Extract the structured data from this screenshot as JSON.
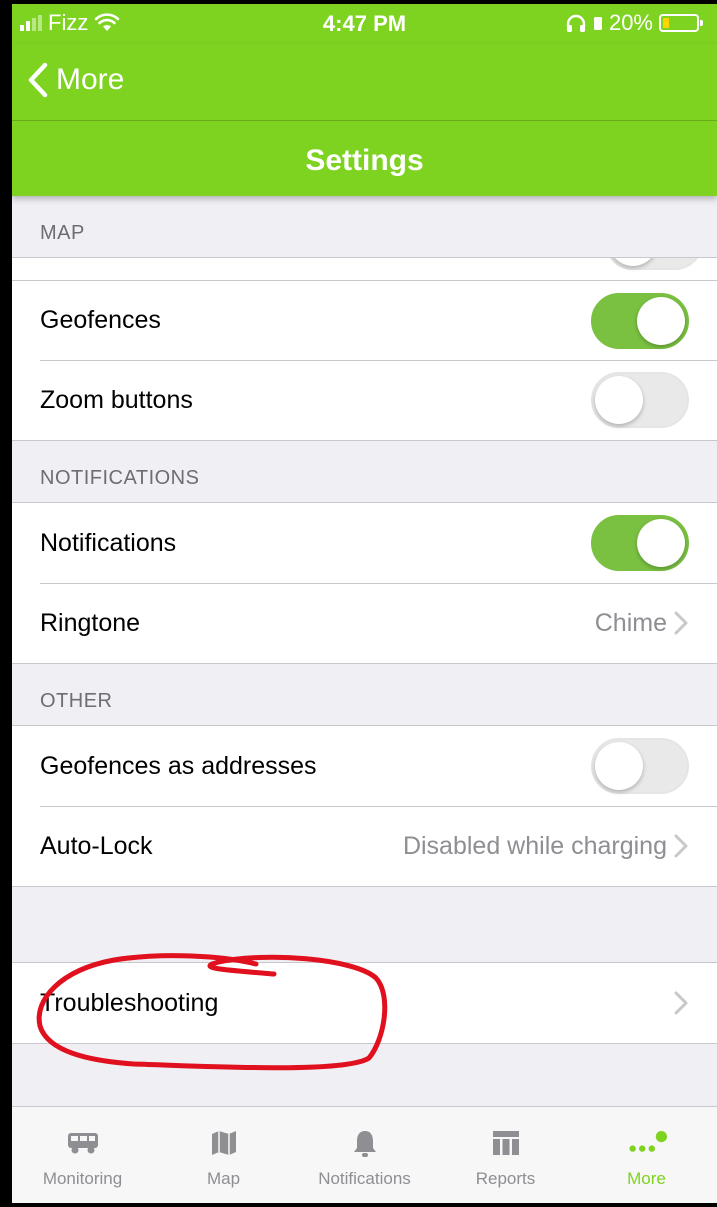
{
  "status_bar": {
    "carrier": "Fizz",
    "time": "4:47 PM",
    "battery_text": "20%",
    "battery_level": 0.2
  },
  "nav": {
    "back_label": "More",
    "title": "Settings"
  },
  "sections": {
    "map": {
      "header": "MAP",
      "rows": [
        {
          "label": "Geofences",
          "toggle": true
        },
        {
          "label": "Zoom buttons",
          "toggle": false
        }
      ]
    },
    "notifications": {
      "header": "NOTIFICATIONS",
      "rows": [
        {
          "label": "Notifications",
          "toggle": true
        },
        {
          "label": "Ringtone",
          "value": "Chime"
        }
      ]
    },
    "other": {
      "header": "OTHER",
      "rows": [
        {
          "label": "Geofences as addresses",
          "toggle": false
        },
        {
          "label": "Auto-Lock",
          "value": "Disabled while charging"
        }
      ]
    },
    "troubleshooting": {
      "label": "Troubleshooting"
    }
  },
  "tabbar": {
    "tabs": [
      {
        "label": "Monitoring",
        "icon": "van-icon"
      },
      {
        "label": "Map",
        "icon": "map-icon"
      },
      {
        "label": "Notifications",
        "icon": "bell-icon"
      },
      {
        "label": "Reports",
        "icon": "table-icon"
      },
      {
        "label": "More",
        "icon": "more-dots-icon",
        "active": true
      }
    ]
  },
  "colors": {
    "brand_green": "#7ed321",
    "toggle_on": "#7ac142",
    "annotation_red": "#e0101e",
    "secondary_text": "#8e8e93"
  }
}
